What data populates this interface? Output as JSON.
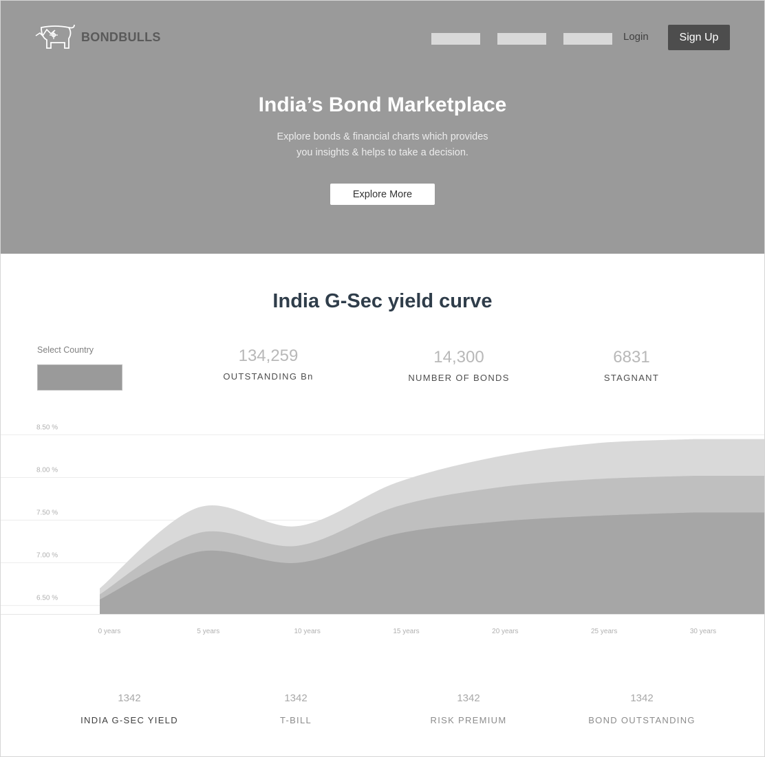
{
  "brand": {
    "name": "BONDBULLS",
    "logo_icon": "bull-chart-icon"
  },
  "nav": {
    "login": "Login",
    "signup": "Sign Up"
  },
  "hero": {
    "title": "India’s Bond Marketplace",
    "subtitle_line1": "Explore bonds & financial charts which provides",
    "subtitle_line2": "you insights & helps to take a decision.",
    "cta": "Explore More"
  },
  "section": {
    "title": "India G-Sec yield curve",
    "select_label": "Select Country"
  },
  "stats": [
    {
      "value": "134,259",
      "label": "OUTSTANDING Bn"
    },
    {
      "value": "14,300",
      "label": "NUMBER OF BONDS"
    },
    {
      "value": "6831",
      "label": "STAGNANT"
    }
  ],
  "chart_data": {
    "type": "area",
    "x": [
      0,
      5,
      10,
      15,
      20,
      25,
      30
    ],
    "x_tick_labels": [
      "0 years",
      "5 years",
      "10 years",
      "15 years",
      "20 years",
      "25 years",
      "30 years"
    ],
    "y_tick_labels": [
      "8.50 %",
      "8.00 %",
      "7.50 %",
      "7.00 %",
      "6.50 %"
    ],
    "y_ticks": [
      8.5,
      8.0,
      7.5,
      7.0,
      6.5
    ],
    "ylim": [
      6.4,
      8.6
    ],
    "series": [
      {
        "values": [
          6.7,
          7.65,
          7.43,
          7.94,
          8.24,
          8.4,
          8.45
        ],
        "color": "#d9d9d9"
      },
      {
        "values": [
          6.63,
          7.35,
          7.2,
          7.66,
          7.88,
          7.98,
          8.02
        ],
        "color": "#bfbfbf"
      },
      {
        "values": [
          6.57,
          7.13,
          7.0,
          7.34,
          7.48,
          7.55,
          7.59
        ],
        "color": "#a6a6a6"
      }
    ],
    "grid": true,
    "legend": "none"
  },
  "bottom_stats": [
    {
      "value": "1342",
      "label": "INDIA G-SEC YIELD",
      "color": "#3e3e3e"
    },
    {
      "value": "1342",
      "label": "T-BILL",
      "color": "#8c8c8c"
    },
    {
      "value": "1342",
      "label": "RISK PREMIUM",
      "color": "#8c8c8c"
    },
    {
      "value": "1342",
      "label": "BOND OUTSTANDING",
      "color": "#8c8c8c"
    }
  ]
}
